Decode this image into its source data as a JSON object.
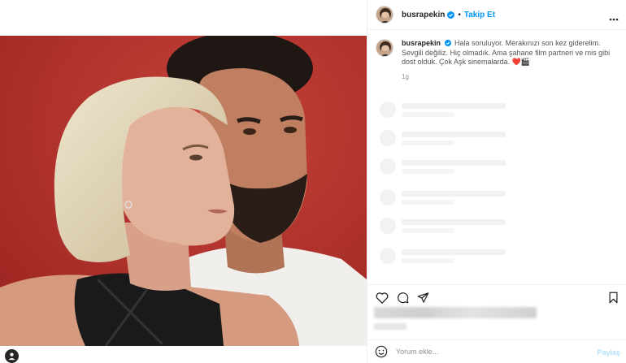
{
  "post": {
    "username": "busrapekin",
    "separator": "•",
    "follow_label": "Takip Et",
    "caption": "Hala soruluyor. Merakınızı son kez giderelim. Sevgili değiliz. Hiç olmadık. Ama şahane film partneri ve mis gibi dost olduk. Çok Aşk sinemalarda. ❤️🎬",
    "time_ago": "1g"
  },
  "comment": {
    "placeholder": "Yorum ekle...",
    "post_label": "Paylaş"
  },
  "icons": {
    "verified": "verified-badge-icon",
    "more": "more-options-icon",
    "like": "heart-icon",
    "comment": "comment-icon",
    "share": "share-icon",
    "save": "bookmark-icon",
    "emoji": "emoji-icon",
    "user_tag": "user-tag-icon"
  },
  "colors": {
    "link_blue": "#0095f6",
    "photo_background": "#b8302c",
    "verified": "#0095f6"
  }
}
